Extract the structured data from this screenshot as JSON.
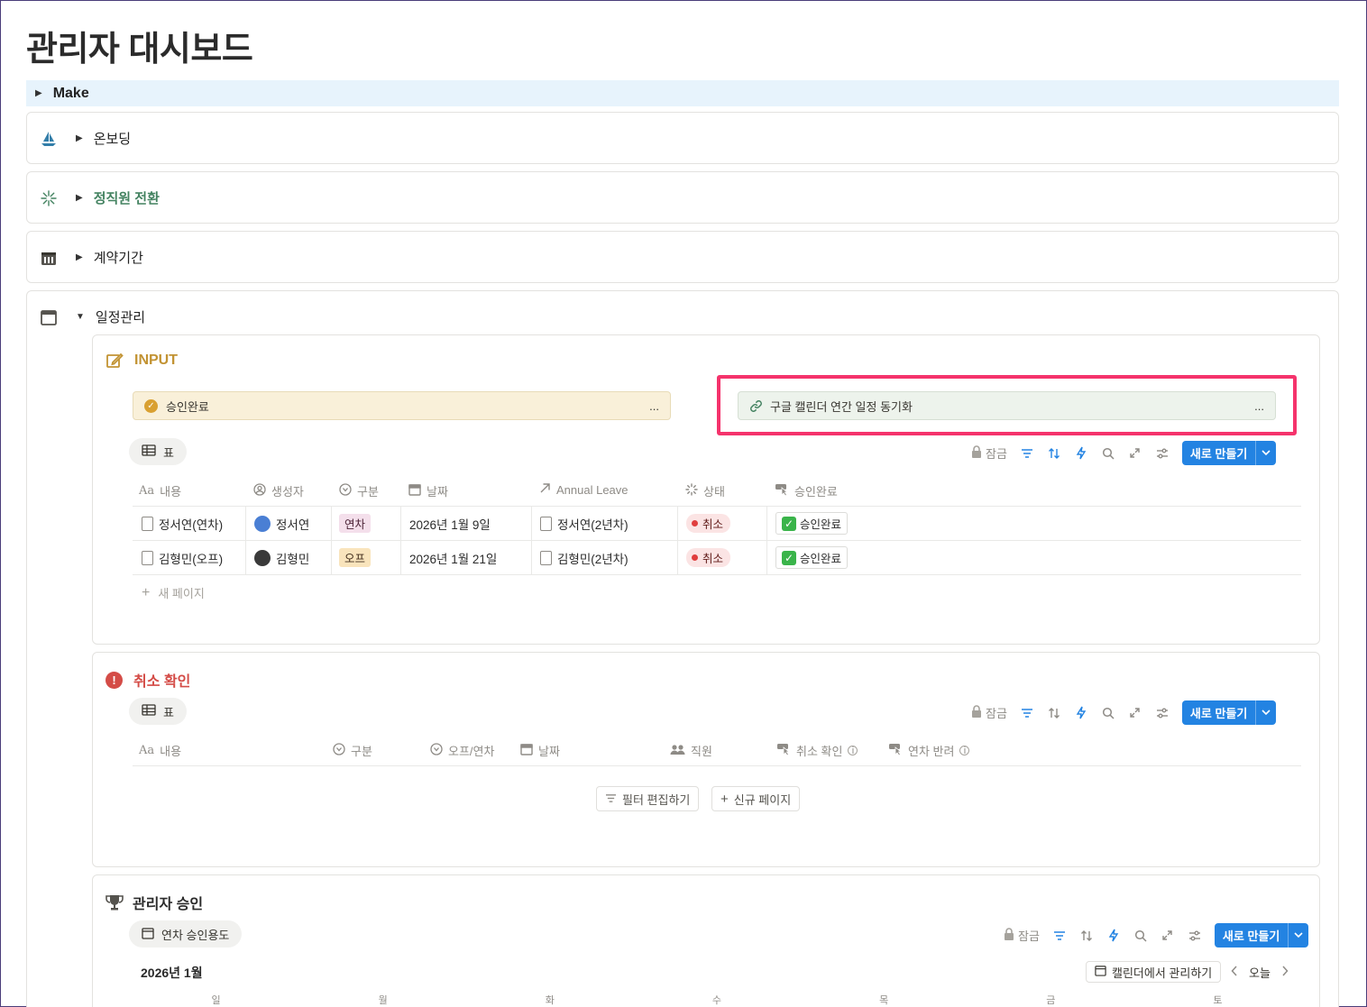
{
  "page": {
    "title": "관리자 대시보드"
  },
  "make": {
    "label": "Make"
  },
  "sections": {
    "onboarding": "온보딩",
    "conversion": "정직원 전환",
    "contract": "계약기간",
    "schedule": "일정관리"
  },
  "input_block": {
    "title": "INPUT",
    "button_approved": "승인완료",
    "button_sync": "구글 캘린더 연간 일정 동기화",
    "ellipsis": "...",
    "view_tab": "표",
    "toolbar": {
      "lock_label": "잠금",
      "new_label": "새로 만들기"
    },
    "columns": [
      "내용",
      "생성자",
      "구분",
      "날짜",
      "Annual Leave",
      "상태",
      "승인완료"
    ],
    "aa": "Aa",
    "rows": [
      {
        "title": "정서연(연차)",
        "creator": "정서연",
        "type": "연차",
        "date": "2026년 1월 9일",
        "leave": "정서연(2년차)",
        "status": "취소",
        "approved": "승인완료"
      },
      {
        "title": "김형민(오프)",
        "creator": "김형민",
        "type": "오프",
        "date": "2026년 1월 21일",
        "leave": "김형민(2년차)",
        "status": "취소",
        "approved": "승인완료"
      }
    ],
    "new_page": "새 페이지"
  },
  "cancel_block": {
    "title": "취소 확인",
    "view_tab": "표",
    "toolbar": {
      "lock_label": "잠금",
      "new_label": "새로 만들기"
    },
    "columns": [
      "내용",
      "구분",
      "오프/연차",
      "날짜",
      "직원",
      "취소 확인",
      "연차 반려"
    ],
    "aa": "Aa",
    "edit_filter": "필터 편집하기",
    "new_page": "신규 페이지"
  },
  "admin_block": {
    "title": "관리자 승인",
    "view_tab": "연차 승인용도",
    "toolbar": {
      "lock_label": "잠금",
      "new_label": "새로 만들기"
    },
    "month": "2026년 1월",
    "manage_in_calendar": "캘린더에서 관리하기",
    "today": "오늘",
    "weekdays": [
      "일",
      "월",
      "화",
      "수",
      "목",
      "금",
      "토"
    ]
  },
  "colors": {
    "accent": "#2383e2",
    "highlight": "#f5336c",
    "input_title": "#c29333",
    "cancel_title": "#d44c47",
    "conversion_title": "#448361"
  }
}
